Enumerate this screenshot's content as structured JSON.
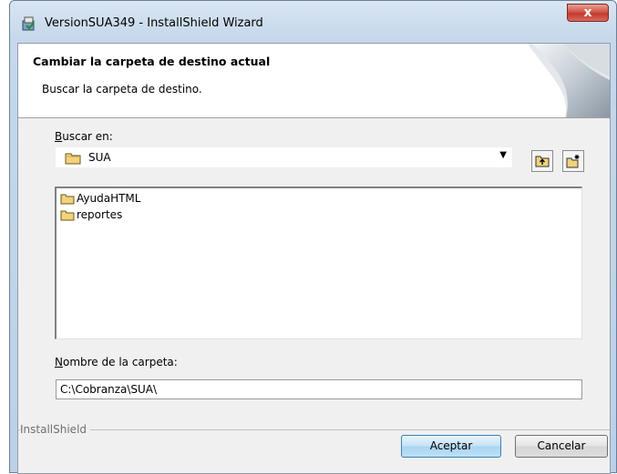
{
  "window": {
    "title": "VersionSUA349 - InstallShield Wizard",
    "close_label": "x"
  },
  "header": {
    "title": "Cambiar la carpeta de destino actual",
    "subtitle": "Buscar la carpeta de destino."
  },
  "look_in": {
    "label_accel": "B",
    "label_rest": "uscar en:",
    "selected": "SUA"
  },
  "toolbar": {
    "up_icon": "folder-up-icon",
    "new_folder_icon": "new-folder-icon"
  },
  "folders": [
    {
      "name": "AyudaHTML"
    },
    {
      "name": "reportes"
    }
  ],
  "folder_name": {
    "label_accel": "N",
    "label_rest": "ombre de la carpeta:",
    "value": "C:\\Cobranza\\SUA\\"
  },
  "footer": {
    "brand": "InstallShield",
    "ok_label": "Aceptar",
    "cancel_label": "Cancelar"
  },
  "colors": {
    "accent": "#3c7fb1",
    "close": "#c23a2e"
  }
}
